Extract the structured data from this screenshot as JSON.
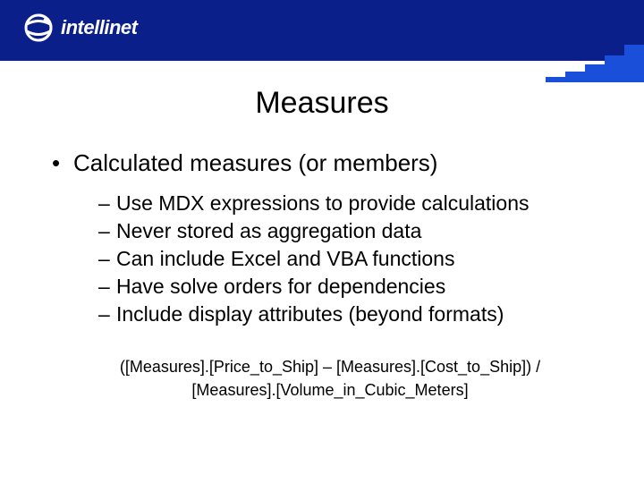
{
  "brand": {
    "name": "intellinet"
  },
  "slide": {
    "title": "Measures",
    "bullet_main": "Calculated measures (or members)",
    "sub_items": [
      "Use MDX expressions to provide calculations",
      "Never stored as aggregation data",
      "Can include Excel and VBA functions",
      "Have solve orders for dependencies",
      "Include display attributes (beyond formats)"
    ],
    "formula_line1": "([Measures].[Price_to_Ship] – [Measures].[Cost_to_Ship]) /",
    "formula_line2": "[Measures].[Volume_in_Cubic_Meters]"
  }
}
